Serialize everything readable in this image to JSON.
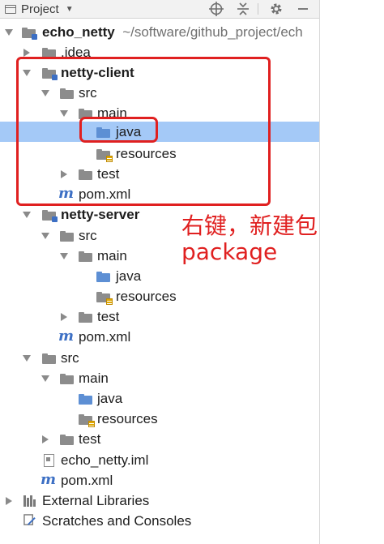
{
  "toolbar": {
    "pane_title": "Project",
    "icons": [
      "project-pane-icon",
      "crosshair-icon",
      "collapse-all-icon",
      "gear-icon",
      "minimize-icon"
    ]
  },
  "tree": {
    "root_name": "echo_netty",
    "root_path": "~/software/github_project/ech",
    "idea": ".idea",
    "client_module": "netty-client",
    "client_src": "src",
    "client_main": "main",
    "client_java": "java",
    "client_resources": "resources",
    "client_test": "test",
    "client_pom": "pom.xml",
    "server_module": "netty-server",
    "server_src": "src",
    "server_main": "main",
    "server_java": "java",
    "server_resources": "resources",
    "server_test": "test",
    "server_pom": "pom.xml",
    "root_src": "src",
    "root_main": "main",
    "root_java": "java",
    "root_resources": "resources",
    "root_test": "test",
    "root_iml": "echo_netty.iml",
    "root_pom": "pom.xml",
    "external_libraries": "External Libraries",
    "scratches": "Scratches and Consoles"
  },
  "annotation": {
    "line1": "右键，新建包",
    "line2": "package",
    "color": "#e02020"
  },
  "colors": {
    "selection": "#a4c9f7",
    "folder_blue": "#5d8fd4",
    "folder_grey": "#8c8c8c"
  }
}
